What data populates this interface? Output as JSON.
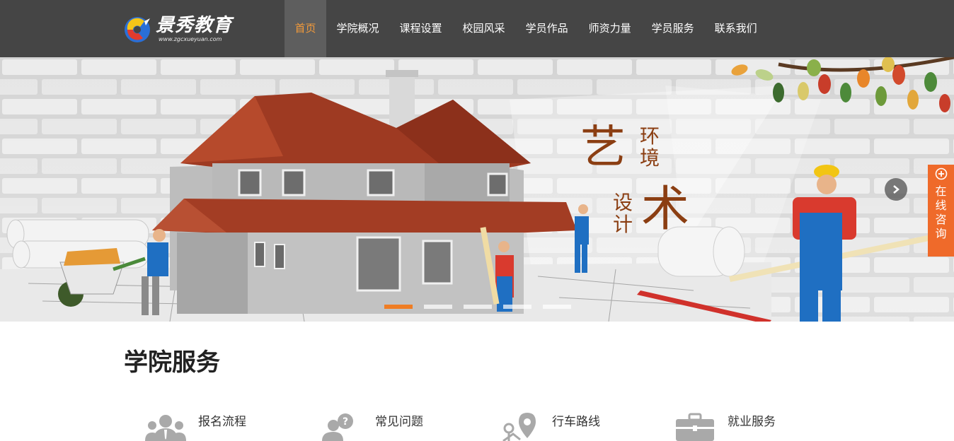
{
  "header": {
    "logo": {
      "name": "景秀教育",
      "url": "www.zgcxueyuan.com"
    },
    "nav": [
      {
        "label": "首页",
        "active": true
      },
      {
        "label": "学院概况",
        "active": false
      },
      {
        "label": "课程设置",
        "active": false
      },
      {
        "label": "校园风采",
        "active": false
      },
      {
        "label": "学员作品",
        "active": false
      },
      {
        "label": "师资力量",
        "active": false
      },
      {
        "label": "学员服务",
        "active": false
      },
      {
        "label": "联系我们",
        "active": false
      }
    ]
  },
  "banner": {
    "title_art": {
      "big_1": "艺",
      "small_1": "环境",
      "small_2": "设计",
      "big_2": "术"
    },
    "next_icon": "chevron-right-icon",
    "slides_count": 5,
    "active_slide": 1
  },
  "consult": {
    "label": "在线咨询",
    "icon": "plus-circle-icon"
  },
  "services": {
    "title": "学院服务",
    "items": [
      {
        "label": "报名流程",
        "icon": "users-icon"
      },
      {
        "label": "常见问题",
        "icon": "question-user-icon"
      },
      {
        "label": "行车路线",
        "icon": "map-pin-icon"
      },
      {
        "label": "就业服务",
        "icon": "briefcase-icon"
      }
    ]
  },
  "colors": {
    "header_bg": "#454545",
    "nav_active_bg": "#5e5e5e",
    "nav_active_text": "#f39a3a",
    "accent_orange": "#ef6a2a",
    "banner_title": "#8b3e12"
  }
}
